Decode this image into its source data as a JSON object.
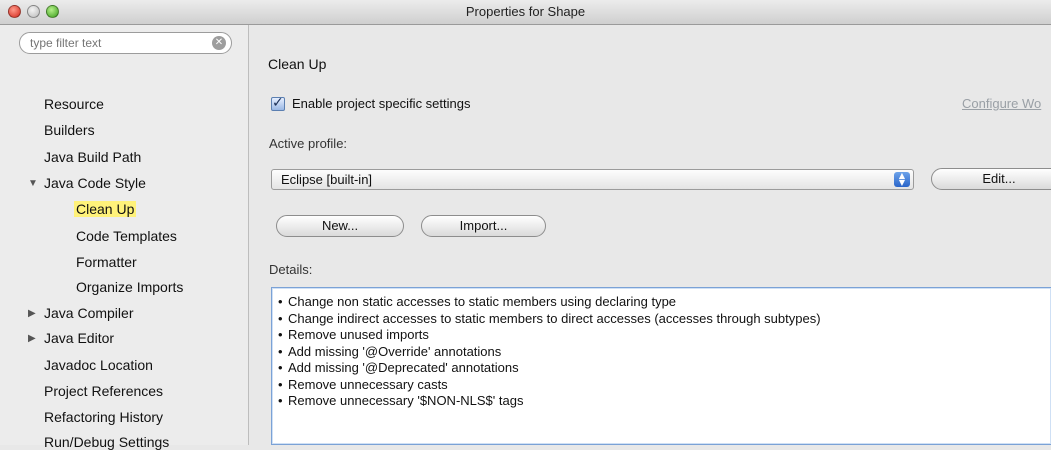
{
  "window": {
    "title": "Properties for Shape"
  },
  "filter": {
    "placeholder": "type filter text"
  },
  "sidebar": {
    "items": [
      {
        "label": "Resource"
      },
      {
        "label": "Builders"
      },
      {
        "label": "Java Build Path"
      },
      {
        "label": "Java Code Style",
        "expanded": true
      },
      {
        "label": "Clean Up",
        "selected": true
      },
      {
        "label": "Code Templates"
      },
      {
        "label": "Formatter"
      },
      {
        "label": "Organize Imports"
      },
      {
        "label": "Java Compiler",
        "collapsed": true
      },
      {
        "label": "Java Editor",
        "collapsed": true
      },
      {
        "label": "Javadoc Location"
      },
      {
        "label": "Project References"
      },
      {
        "label": "Refactoring History"
      },
      {
        "label": "Run/Debug Settings"
      }
    ]
  },
  "main": {
    "title": "Clean Up",
    "enable_label": "Enable project specific settings",
    "enable_checked": true,
    "configure_link": "Configure Wo",
    "active_profile_label": "Active profile:",
    "profile_value": "Eclipse [built-in]",
    "edit_button": "Edit...",
    "new_button": "New...",
    "import_button": "Import...",
    "details_label": "Details:",
    "details": [
      "Change non static accesses to static members using declaring type",
      "Change indirect accesses to static members to direct accesses (accesses through subtypes)",
      "Remove unused imports",
      "Add missing '@Override' annotations",
      "Add missing '@Deprecated' annotations",
      "Remove unnecessary casts",
      "Remove unnecessary '$NON-NLS$' tags"
    ]
  },
  "colors": {
    "selection": "#fff27a",
    "accent": "#2a65c9"
  }
}
